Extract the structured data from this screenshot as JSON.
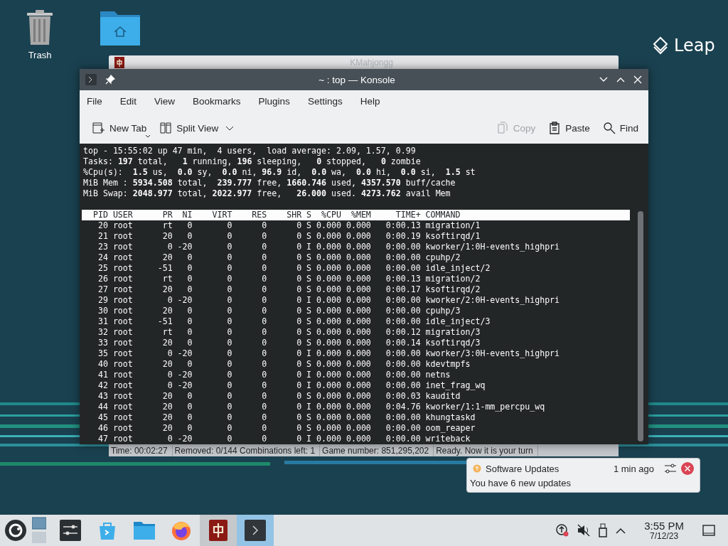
{
  "desktop": {
    "icons": [
      {
        "kind": "trash",
        "label": "Trash"
      },
      {
        "kind": "home-folder"
      }
    ],
    "brand": "Leap"
  },
  "background_window": {
    "title": "KMahjongg",
    "status_bar": [
      "Time: 00:02:27",
      "Removed: 0/144  Combinations left: 1",
      "Game number: 851,295,202",
      "Ready. Now it is your turn"
    ]
  },
  "terminal_window": {
    "title": "~ : top — Konsole",
    "menu": [
      "File",
      "Edit",
      "View",
      "Bookmarks",
      "Plugins",
      "Settings",
      "Help"
    ],
    "toolbar": [
      {
        "kind": "new-tab",
        "label": "New Tab",
        "disabled": false
      },
      {
        "kind": "split-view",
        "label": "Split View",
        "disabled": false
      },
      {
        "kind": "copy",
        "label": "Copy",
        "disabled": true
      },
      {
        "kind": "paste",
        "label": "Paste",
        "disabled": false
      },
      {
        "kind": "find",
        "label": "Find",
        "disabled": false
      }
    ],
    "summary_lines": [
      "top - 15:55:02 up 47 min,  4 users,  load average: 2.09, 1.57, 0.99",
      "Tasks: **197** total,   **1** running, **196** sleeping,   **0** stopped,   **0** zombie",
      "%Cpu(s):  **1.5** us,  **0.0** sy,  **0.0** ni, **96.9** id,  **0.0** wa,  **0.0** hi,  **0.0** si,  **1.5** st",
      "MiB Mem : **5934.508** total,  **239.777** free, **1660.746** used, **4357.570** buff/cache",
      "MiB Swap: **2048.977** total, **2022.977** free,   **26.000** used. **4273.762** avail Mem"
    ],
    "process_header": "  PID USER      PR  NI    VIRT    RES    SHR S  %CPU  %MEM     TIME+ COMMAND",
    "process_rows": [
      "   20 root      rt   0       0      0      0 S 0.000 0.000   0:00.13 migration/1",
      "   21 root      20   0       0      0      0 S 0.000 0.000   0:00.19 ksoftirqd/1",
      "   23 root       0 -20       0      0      0 I 0.000 0.000   0:00.00 kworker/1:0H-events_highpri",
      "   24 root      20   0       0      0      0 S 0.000 0.000   0:00.00 cpuhp/2",
      "   25 root     -51   0       0      0      0 S 0.000 0.000   0:00.00 idle_inject/2",
      "   26 root      rt   0       0      0      0 S 0.000 0.000   0:00.13 migration/2",
      "   27 root      20   0       0      0      0 S 0.000 0.000   0:00.17 ksoftirqd/2",
      "   29 root       0 -20       0      0      0 I 0.000 0.000   0:00.00 kworker/2:0H-events_highpri",
      "   30 root      20   0       0      0      0 S 0.000 0.000   0:00.00 cpuhp/3",
      "   31 root     -51   0       0      0      0 S 0.000 0.000   0:00.00 idle_inject/3",
      "   32 root      rt   0       0      0      0 S 0.000 0.000   0:00.12 migration/3",
      "   33 root      20   0       0      0      0 S 0.000 0.000   0:00.14 ksoftirqd/3",
      "   35 root       0 -20       0      0      0 I 0.000 0.000   0:00.00 kworker/3:0H-events_highpri",
      "   40 root      20   0       0      0      0 S 0.000 0.000   0:00.00 kdevtmpfs",
      "   41 root       0 -20       0      0      0 I 0.000 0.000   0:00.00 netns",
      "   42 root       0 -20       0      0      0 I 0.000 0.000   0:00.00 inet_frag_wq",
      "   43 root      20   0       0      0      0 S 0.000 0.000   0:00.03 kauditd",
      "   44 root      20   0       0      0      0 I 0.000 0.000   0:04.76 kworker/1:1-mm_percpu_wq",
      "   45 root      20   0       0      0      0 S 0.000 0.000   0:00.00 khungtaskd",
      "   46 root      20   0       0      0      0 S 0.000 0.000   0:00.00 oom_reaper",
      "   47 root       0 -20       0      0      0 I 0.000 0.000   0:00.00 writeback"
    ]
  },
  "notification": {
    "title": "Software Updates",
    "time": "1 min ago",
    "message": "You have 6 new updates"
  },
  "taskbar": {
    "apps": [
      {
        "kind": "settings",
        "open": false,
        "selected": false
      },
      {
        "kind": "discover",
        "open": false,
        "selected": false
      },
      {
        "kind": "files",
        "open": false,
        "selected": false
      },
      {
        "kind": "browser",
        "open": false,
        "selected": false
      },
      {
        "kind": "mahjongg",
        "open": true,
        "selected": false
      },
      {
        "kind": "terminal",
        "open": true,
        "selected": true
      }
    ],
    "tray": [
      {
        "kind": "updates"
      },
      {
        "kind": "muted"
      },
      {
        "kind": "device"
      },
      {
        "kind": "expand"
      }
    ],
    "clock": {
      "time": "3:55 PM",
      "date": "7/12/23"
    }
  }
}
